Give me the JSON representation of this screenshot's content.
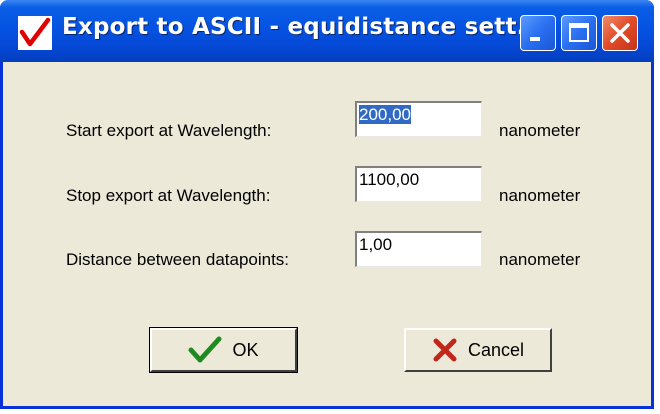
{
  "window": {
    "title": "Export to ASCII - equidistance sett...",
    "title_icon": "red-checkmark-icon",
    "controls": [
      "minimize-icon",
      "maximize-icon",
      "close-icon"
    ],
    "titlebar_color": "#0553e1",
    "body_color": "#ece9d8"
  },
  "form": {
    "start": {
      "label": "Start export at Wavelength:",
      "value": "200,00",
      "unit": "nanometer"
    },
    "stop": {
      "label": "Stop export at Wavelength:",
      "value": "1100,00",
      "unit": "nanometer"
    },
    "distance": {
      "label": "Distance between datapoints:",
      "value": "1,00",
      "unit": "nanometer"
    }
  },
  "buttons": {
    "ok_label": "OK",
    "ok_icon": "green-check-icon",
    "cancel_label": "Cancel",
    "cancel_icon": "red-x-icon"
  }
}
